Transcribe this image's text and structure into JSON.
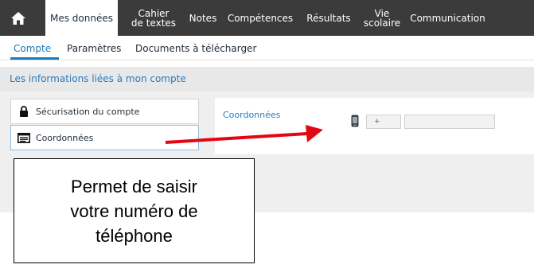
{
  "nav": {
    "home": "home-icon",
    "items": [
      {
        "label": "Mes données",
        "active": true
      },
      {
        "label": "Cahier\nde textes"
      },
      {
        "label": "Notes"
      },
      {
        "label": "Compétences"
      },
      {
        "label": "Résultats"
      },
      {
        "label": "Vie\nscolaire"
      },
      {
        "label": "Communication"
      }
    ]
  },
  "subtabs": [
    {
      "label": "Compte",
      "active": true
    },
    {
      "label": "Paramètres"
    },
    {
      "label": "Documents à télécharger"
    }
  ],
  "section": {
    "title": "Les informations liées à mon compte"
  },
  "menu": [
    {
      "label": "Sécurisation du compte",
      "icon": "lock-icon"
    },
    {
      "label": "Coordonnées",
      "icon": "id-card-icon",
      "active": true
    }
  ],
  "panel": {
    "label": "Coordonnées",
    "phone_icon": "phone-icon",
    "prefix_value": "+",
    "number_value": ""
  },
  "callout": {
    "lines": [
      "Permet de saisir",
      "votre numéro de",
      "téléphone"
    ]
  },
  "colors": {
    "accent": "#1a7abf",
    "topbar": "#3b3b3b",
    "arrow": "#e30613"
  }
}
